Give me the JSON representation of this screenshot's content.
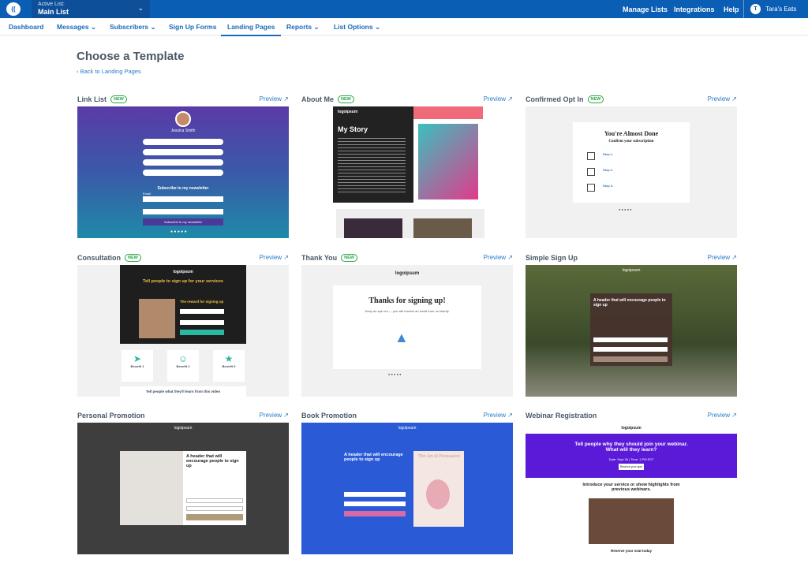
{
  "header": {
    "active_list_label": "Active List:",
    "active_list_value": "Main List",
    "manage_lists": "Manage Lists",
    "integrations": "Integrations",
    "help": "Help",
    "user_initial": "T",
    "user_name": "Tara's Eats"
  },
  "subnav": {
    "items": [
      {
        "label": "Dashboard"
      },
      {
        "label": "Messages"
      },
      {
        "label": "Subscribers"
      },
      {
        "label": "Sign Up Forms"
      },
      {
        "label": "Landing Pages"
      },
      {
        "label": "Reports"
      },
      {
        "label": "List Options"
      }
    ]
  },
  "page": {
    "title": "Choose a Template",
    "back_link": "Back to Landing Pages"
  },
  "templates": [
    {
      "name": "Link List",
      "new": "NEW",
      "preview": "Preview"
    },
    {
      "name": "About Me",
      "new": "NEW",
      "preview": "Preview"
    },
    {
      "name": "Confirmed Opt In",
      "new": "NEW",
      "preview": "Preview"
    },
    {
      "name": "Consultation",
      "new": "NEW",
      "preview": "Preview"
    },
    {
      "name": "Thank You",
      "new": "NEW",
      "preview": "Preview"
    },
    {
      "name": "Simple Sign Up",
      "preview": "Preview"
    },
    {
      "name": "Personal Promotion",
      "preview": "Preview"
    },
    {
      "name": "Book Promotion",
      "preview": "Preview"
    },
    {
      "name": "Webinar Registration",
      "preview": "Preview"
    }
  ],
  "thumbs": {
    "linklist": {
      "name": "Jessica Smith",
      "subscribe": "Subscribe to my newsletter",
      "email": "Email",
      "button": "Subscribe to my newsletter"
    },
    "aboutme": {
      "logo": "logoipsum",
      "heading": "My Story"
    },
    "confirm": {
      "heading": "You're Almost Done",
      "sub": "Confirm your subscription",
      "step1": "Step 1.",
      "step2": "Step 2.",
      "step3": "Step 3."
    },
    "consult": {
      "logo": "logoipsum",
      "heading": "Tell people to sign up for your services",
      "reward": "The reward for signing up",
      "b1": "Benefit 1",
      "b2": "Benefit 2",
      "b3": "Benefit 3",
      "bottom": "Tell people what they'll learn from this video"
    },
    "thanks": {
      "logo": "logoipsum",
      "heading": "Thanks for signing up!",
      "sub": "Keep an eye out — you will receive an email from us shortly."
    },
    "simple": {
      "logo": "logoipsum",
      "heading": "A header that will encourage people to sign up"
    },
    "personal": {
      "logo": "logoipsum",
      "heading": "A header that will encourage people to sign up"
    },
    "book": {
      "logo": "logoipsum",
      "heading": "A header that will encourage people to sign up",
      "book_title": "The Art of Persuasion"
    },
    "webinar": {
      "logo": "logoipsum",
      "heading": "Tell people why they should join your webinar. What will they learn?",
      "date": "Date: Sept 26 | Time: 1 PM EST",
      "cta": "Reserve your spot",
      "intro": "Introduce your service or show highlights from previous webinars.",
      "reserve": "Reserve your seat today"
    }
  }
}
